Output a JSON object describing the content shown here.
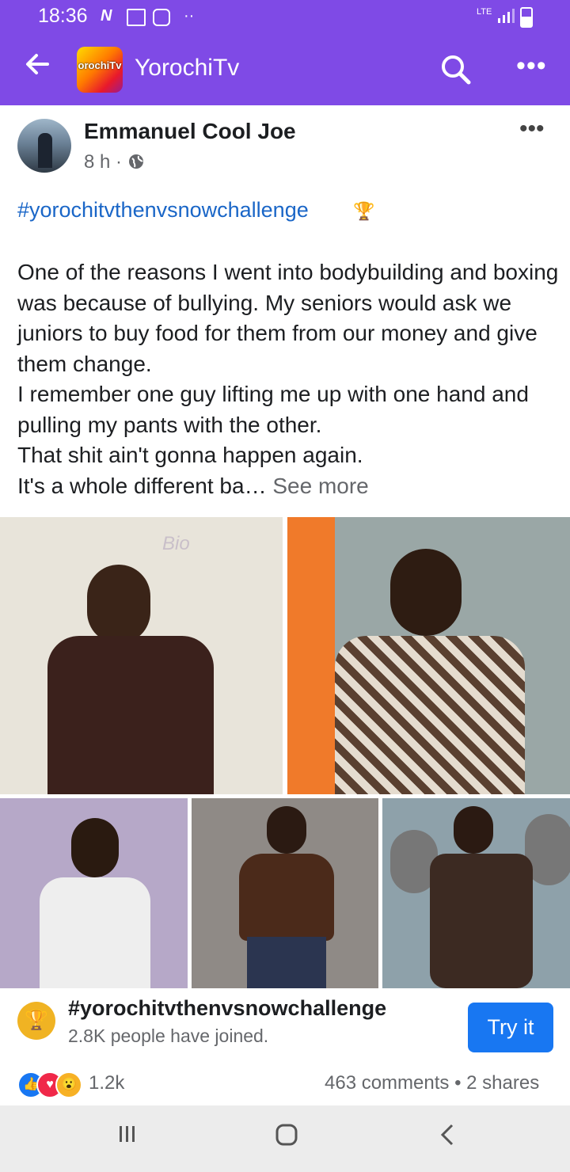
{
  "status_bar": {
    "time": "18:36",
    "network": "LTE"
  },
  "app_bar": {
    "title": "YorochiTv",
    "logo_text": "orochiTv"
  },
  "post": {
    "author": "Emmanuel Cool Joe",
    "time": "8 h",
    "separator": "·",
    "hashtag": "#yorochitvthenvsnowchallenge",
    "body": "One of the reasons I went into bodybuilding and boxing was because of bullying. My seniors would ask we juniors to buy food for them from our money and give them change.\nI remember one guy lifting me up with one hand and pulling my pants with the other.\nThat shit ain't gonna happen again.\nIt's a whole different ba…",
    "see_more": "See more",
    "photos": [
      {
        "alt": "young boy in dark shirt in front of whiteboard"
      },
      {
        "alt": "young man in checkered shirt"
      },
      {
        "alt": "man in white vest"
      },
      {
        "alt": "shirtless bodybuilder posing"
      },
      {
        "alt": "man lifting barbell in gym"
      }
    ]
  },
  "challenge": {
    "title": "#yorochitvthenvsnowchallenge",
    "subtitle": "2.8K people have joined.",
    "button": "Try it"
  },
  "engagement": {
    "reactions_count": "1.2k",
    "stats": "463 comments • 2 shares"
  },
  "colors": {
    "brand_purple": "#7f4ae6",
    "link_blue": "#1a66c7",
    "button_blue": "#1877f2"
  }
}
